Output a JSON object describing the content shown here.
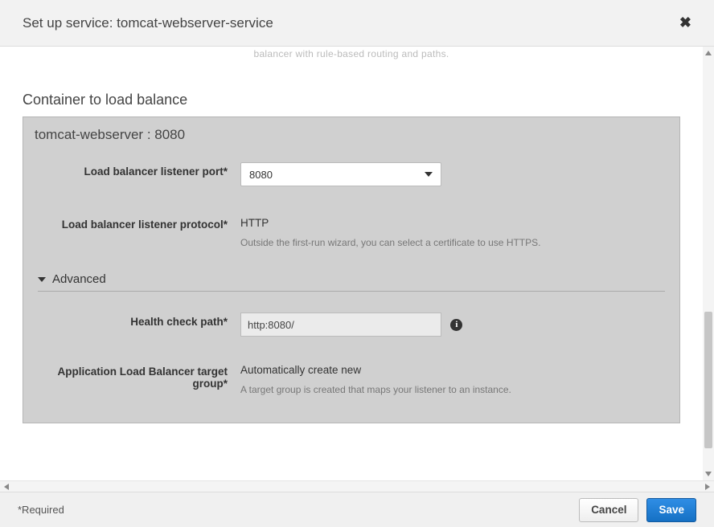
{
  "header": {
    "title": "Set up service: tomcat-webserver-service"
  },
  "top_cut_text": "balancer with rule-based routing and paths.",
  "section_title": "Container to load balance",
  "panel": {
    "title": "tomcat-webserver : 8080",
    "listener_port": {
      "label": "Load balancer listener port*",
      "value": "8080"
    },
    "listener_protocol": {
      "label": "Load balancer listener protocol*",
      "value": "HTTP",
      "hint": "Outside the first-run wizard, you can select a certificate to use HTTPS."
    },
    "advanced_label": "Advanced",
    "health_check": {
      "label": "Health check path*",
      "value": "http:8080/"
    },
    "target_group": {
      "label": "Application Load Balancer target group*",
      "value": "Automatically create new",
      "hint": "A target group is created that maps your listener to an instance."
    }
  },
  "footer": {
    "required": "*Required",
    "cancel": "Cancel",
    "save": "Save"
  }
}
